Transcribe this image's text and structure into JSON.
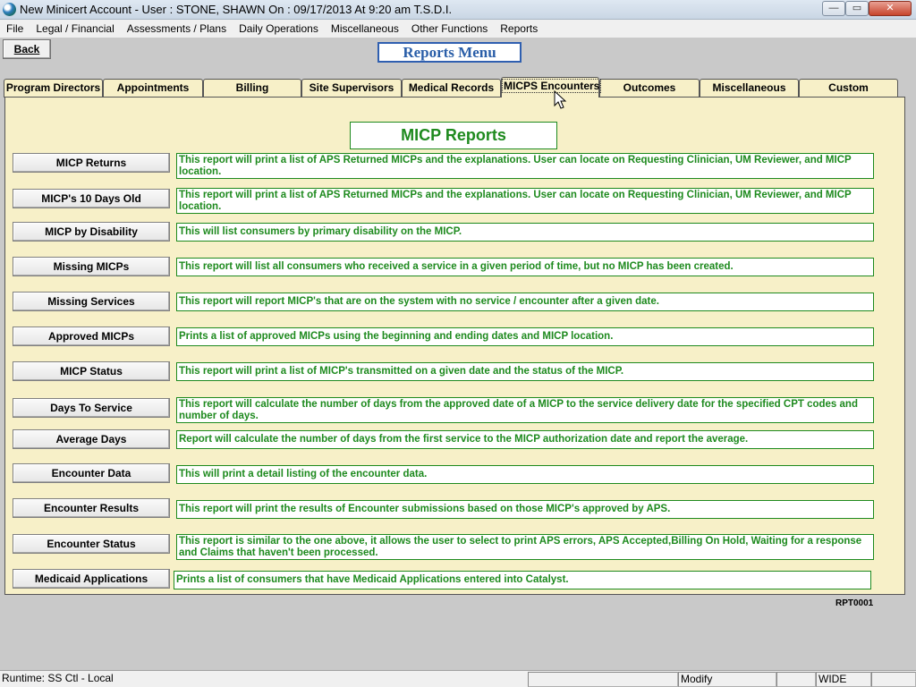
{
  "window": {
    "title": "New Minicert Account  - User : STONE, SHAWN On : 09/17/2013 At  9:20 am  T.S.D.I.",
    "min_glyph": "—",
    "max_glyph": "▭",
    "close_glyph": "✕"
  },
  "menubar": {
    "items": [
      "File",
      "Legal / Financial",
      "Assessments / Plans",
      "Daily Operations",
      "Miscellaneous",
      "Other Functions",
      "Reports"
    ]
  },
  "toolbar": {
    "back_label": "Back",
    "menu_title": "Reports Menu"
  },
  "tabs": {
    "items": [
      "Program Directors",
      "Appointments",
      "Billing",
      "Site Supervisors",
      "Medical Records",
      "MICPS Encounters",
      "Outcomes",
      "Miscellaneous",
      "Custom"
    ],
    "active": "MICPS Encounters"
  },
  "panel": {
    "title": "MICP Reports",
    "reports": [
      {
        "button": "MICP Returns",
        "description": "This report will print a list of APS Returned MICPs and the explanations.  User can locate on Requesting Clinician, UM Reviewer, and MICP location."
      },
      {
        "button": "MICP's 10 Days Old",
        "description": "This report will print a list of APS Returned MICPs and the explanations.  User can locate on Requesting Clinician, UM Reviewer, and MICP location."
      },
      {
        "button": "MICP by Disability",
        "description": "This will list consumers by primary disability on the MICP."
      },
      {
        "button": "Missing MICPs",
        "description": "This report will list all consumers who received a service in a given period of time, but no MICP has been created."
      },
      {
        "button": "Missing Services",
        "description": "This report will report MICP's that are on the system with no service / encounter after a given date."
      },
      {
        "button": "Approved MICPs",
        "description": "Prints a list of approved MICPs using the beginning and ending dates and MICP location."
      },
      {
        "button": "MICP Status",
        "description": "This report will print a list of MICP's transmitted on a given date and the status of the MICP."
      },
      {
        "button": "Days To Service",
        "description": "This report will calculate the number of days from the approved date of a MICP to the service delivery date for the specified CPT codes and number of days."
      },
      {
        "button": "Average Days",
        "description": "Report will calculate the number of days from the first service to the MICP authorization date and report the average."
      },
      {
        "button": "Encounter Data",
        "description": "This will print a detail listing of the encounter data."
      },
      {
        "button": "Encounter Results",
        "description": "This report will print the results of Encounter submissions based on those MICP's approved by APS."
      },
      {
        "button": "Encounter Status",
        "description": "This report is similar to the one above, it allows the user to select to print APS errors, APS Accepted,Billing On Hold, Waiting for a response and Claims that haven't been processed."
      },
      {
        "button": "Medicaid Applications",
        "description": "Prints a list of consumers that have Medicaid Applications entered into Catalyst."
      }
    ],
    "report_code": "RPT0001"
  },
  "statusbar": {
    "runtime": "Runtime: SS Ctl - Local",
    "mode": "Modify",
    "layout": "WIDE"
  },
  "colors": {
    "panel_bg": "#f7f0c8",
    "report_text": "#1e8a1e",
    "menu_title": "#2a5ea8"
  }
}
